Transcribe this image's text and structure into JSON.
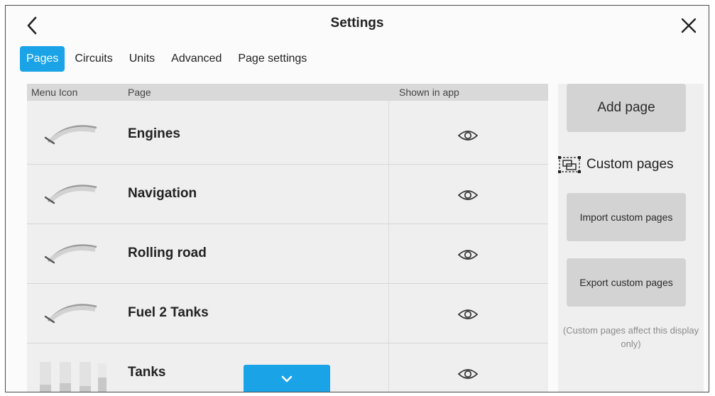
{
  "header": {
    "title": "Settings",
    "back_icon": "chevron-left-icon",
    "close_icon": "close-icon"
  },
  "tabs": [
    {
      "label": "Pages",
      "active": true
    },
    {
      "label": "Circuits",
      "active": false
    },
    {
      "label": "Units",
      "active": false
    },
    {
      "label": "Advanced",
      "active": false
    },
    {
      "label": "Page settings",
      "active": false
    }
  ],
  "table": {
    "columns": {
      "menu_icon": "Menu Icon",
      "page": "Page",
      "shown_in_app": "Shown in app"
    },
    "rows": [
      {
        "name": "Engines",
        "icon": "gauge-icon",
        "shown": true
      },
      {
        "name": "Navigation",
        "icon": "gauge-icon",
        "shown": true
      },
      {
        "name": "Rolling road",
        "icon": "gauge-icon",
        "shown": true
      },
      {
        "name": "Fuel 2 Tanks",
        "icon": "gauge-icon",
        "shown": true
      },
      {
        "name": "Tanks",
        "icon": "tank-icon",
        "shown": true
      }
    ],
    "scroll_icon": "chevron-down-icon"
  },
  "side": {
    "add_page": "Add page",
    "custom_pages": "Custom pages",
    "import": "Import custom pages",
    "export": "Export custom pages",
    "note": "(Custom pages affect this display only)"
  },
  "colors": {
    "accent": "#1aa3e6",
    "button_gray": "#d3d3d3",
    "panel_gray": "#efefef",
    "header_gray": "#d9d9d9"
  }
}
